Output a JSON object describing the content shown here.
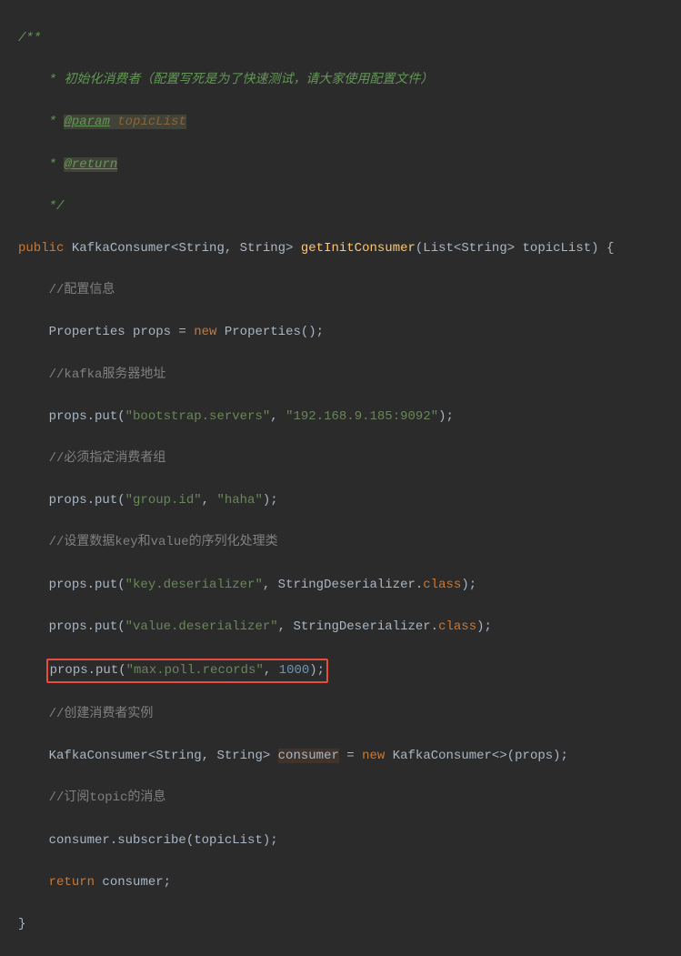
{
  "lines": {
    "l0": "/**",
    "l1_a": " * ",
    "l1_b": "初始化消费者（配置写死是为了快速测试，请大家使用配置文件）",
    "l2_a": " * ",
    "l2_b": "@param",
    "l2_c": " topicList",
    "l3_a": " * ",
    "l3_b": "@return",
    "l4": " */",
    "l5_public": "public",
    "l5_type": " KafkaConsumer<String, String> ",
    "l5_method": "getInitConsumer",
    "l5_sig": "(List<String> topicList) {",
    "l6": "//配置信息",
    "l7_a": "Properties props = ",
    "l7_new": "new",
    "l7_b": " Properties();",
    "l8": "//kafka服务器地址",
    "l9_a": "props.put(",
    "l9_s1": "\"bootstrap.servers\"",
    "l9_c": ", ",
    "l9_s2": "\"192.168.9.185:9092\"",
    "l9_e": ");",
    "l10": "//必须指定消费者组",
    "l11_a": "props.put(",
    "l11_s1": "\"group.id\"",
    "l11_c": ", ",
    "l11_s2": "\"haha\"",
    "l11_e": ");",
    "l12": "//设置数据key和value的序列化处理类",
    "l13_a": "props.put(",
    "l13_s1": "\"key.deserializer\"",
    "l13_c": ", StringDeserializer.",
    "l13_class": "class",
    "l13_e": ");",
    "l14_a": "props.put(",
    "l14_s1": "\"value.deserializer\"",
    "l14_c": ", StringDeserializer.",
    "l14_class": "class",
    "l14_e": ");",
    "l15_a": "props.put(",
    "l15_s1": "\"max.poll.records\"",
    "l15_c": ", ",
    "l15_num": "1000",
    "l15_e": ");",
    "l16": "//创建消费者实例",
    "l17_a": "KafkaConsumer<String, String> ",
    "l17_var": "consumer",
    "l17_b": " = ",
    "l17_new": "new",
    "l17_c": " KafkaConsumer<>(props);",
    "l18": "//订阅topic的消息",
    "l19_a": "consumer.subscribe(topicList);",
    "l20_ret": "return",
    "l20_b": " consumer;",
    "l21": "}"
  }
}
